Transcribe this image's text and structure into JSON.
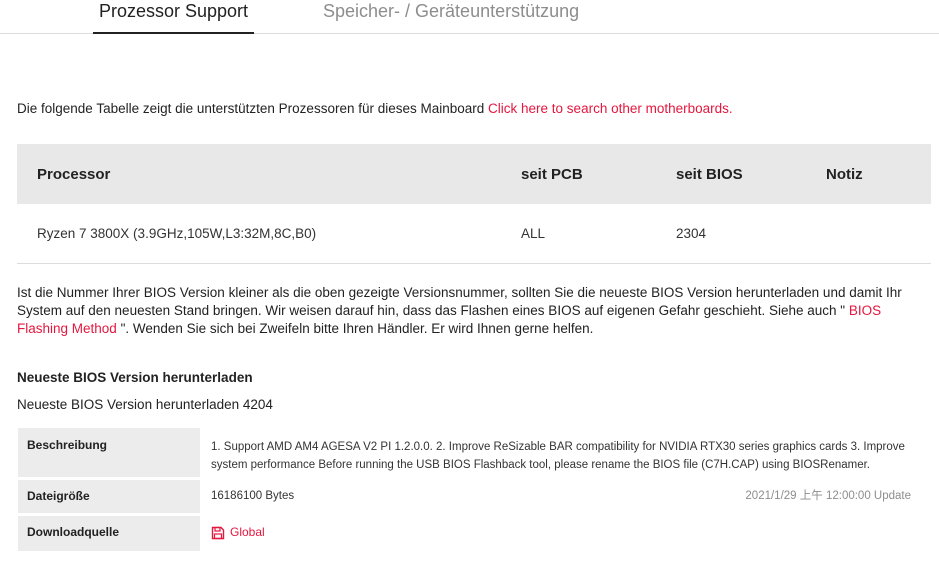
{
  "tabs": {
    "processor": "Prozessor Support",
    "memory": "Speicher- / Geräteunterstützung"
  },
  "intro": {
    "text": "Die folgende Tabelle zeigt die unterstützten Prozessoren für dieses Mainboard ",
    "link": "Click here to search other motherboards."
  },
  "cpu_table": {
    "headers": [
      "Processor",
      "seit PCB",
      "seit BIOS",
      "Notiz"
    ],
    "rows": [
      [
        "Ryzen 7 3800X (3.9GHz,105W,L3:32M,8C,B0)",
        "ALL",
        "2304",
        ""
      ]
    ]
  },
  "notice": {
    "text_before": "Ist die Nummer Ihrer BIOS Version kleiner als die oben gezeigte Versionsnummer, sollten Sie die neueste BIOS Version herunterladen und damit Ihr System auf den neuesten Stand bringen. Wir weisen darauf hin, dass das Flashen eines BIOS auf eigenen Gefahr geschieht. Siehe auch \" ",
    "link": "BIOS Flashing Method",
    "text_after": " \". Wenden Sie sich bei Zweifeln bitte Ihren Händler. Er wird Ihnen gerne helfen."
  },
  "bios": {
    "title": "Neueste BIOS Version herunterladen",
    "subtitle": "Neueste BIOS Version herunterladen 4204",
    "rows": {
      "description_label": "Beschreibung",
      "description_value": "1. Support AMD AM4 AGESA V2 PI 1.2.0.0. 2. Improve ReSizable BAR compatibility for NVIDIA RTX30 series graphics cards 3. Improve system performance Before running the USB BIOS Flashback tool, please rename the BIOS file (C7H.CAP) using BIOSRenamer.",
      "size_label": "Dateigröße",
      "size_value": "16186100 Bytes",
      "date_value": "2021/1/29 上午 12:00:00 Update",
      "source_label": "Downloadquelle",
      "source_value": "Global"
    }
  },
  "colors": {
    "accent": "#e4173e",
    "header_bg": "#e8e8e8",
    "label_bg": "#ececec"
  },
  "icons": {
    "download": "floppy-disk-icon"
  }
}
